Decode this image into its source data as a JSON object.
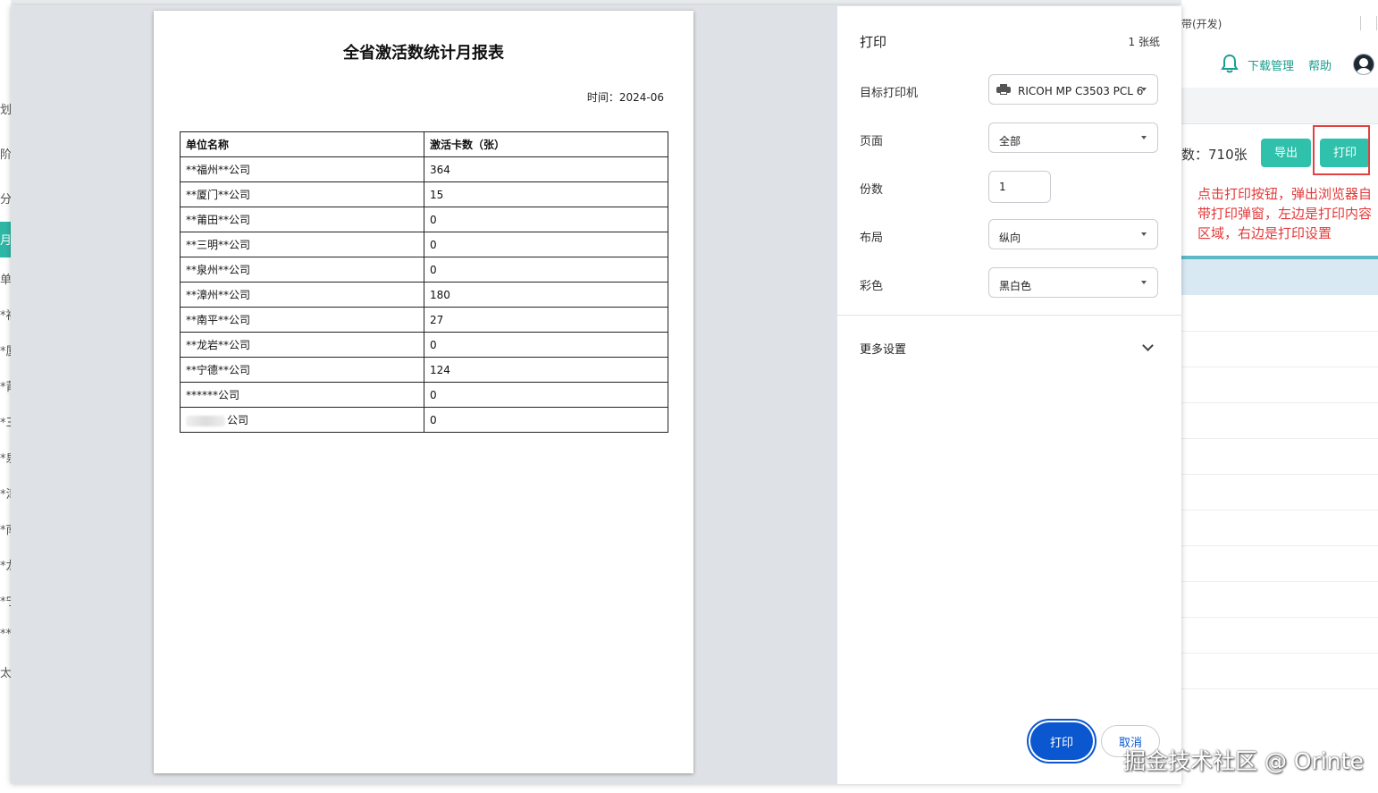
{
  "background": {
    "left_fragments": [
      "划",
      "阶",
      "分:",
      "月",
      "单位",
      "*福",
      "*厦",
      "*莆",
      "*三",
      "*泉",
      "*漳",
      "*南",
      "*龙",
      "*宁",
      "**",
      "太口"
    ],
    "env_label": "带(开发)",
    "header_links": {
      "download": "下载管理",
      "help": "帮助"
    },
    "total_count": "数：710张",
    "export_label": "导出",
    "print_label": "打印",
    "annotation": "点击打印按钮，弹出浏览器自带打印弹窗，左边是打印内容区域，右边是打印设置",
    "accent_color": "#2fc1ab",
    "annotation_color": "#e23a3a"
  },
  "report": {
    "title": "全省激活数统计月报表",
    "date": "时间：2024-06",
    "columns": [
      "单位名称",
      "激活卡数（张）"
    ],
    "rows": [
      [
        "**福州**公司",
        "364"
      ],
      [
        "**厦门**公司",
        "15"
      ],
      [
        "**莆田**公司",
        "0"
      ],
      [
        "**三明**公司",
        "0"
      ],
      [
        "**泉州**公司",
        "0"
      ],
      [
        "**漳州**公司",
        "180"
      ],
      [
        "**南平**公司",
        "27"
      ],
      [
        "**龙岩**公司",
        "0"
      ],
      [
        "**宁德**公司",
        "124"
      ],
      [
        "******公司",
        "0"
      ],
      [
        "公司",
        "0"
      ]
    ]
  },
  "print_settings": {
    "title": "打印",
    "sheets": "1 张纸",
    "printer_label": "目标打印机",
    "printer_value": "RICOH MP C3503 PCL 6",
    "pages_label": "页面",
    "pages_value": "全部",
    "copies_label": "份数",
    "copies_value": "1",
    "layout_label": "布局",
    "layout_value": "纵向",
    "color_label": "彩色",
    "color_value": "黑白色",
    "more_settings": "更多设置",
    "print_button": "打印",
    "cancel_button": "取消",
    "primary_color": "#0b57d0"
  },
  "watermark": "掘金技术社区 @ Orinte"
}
